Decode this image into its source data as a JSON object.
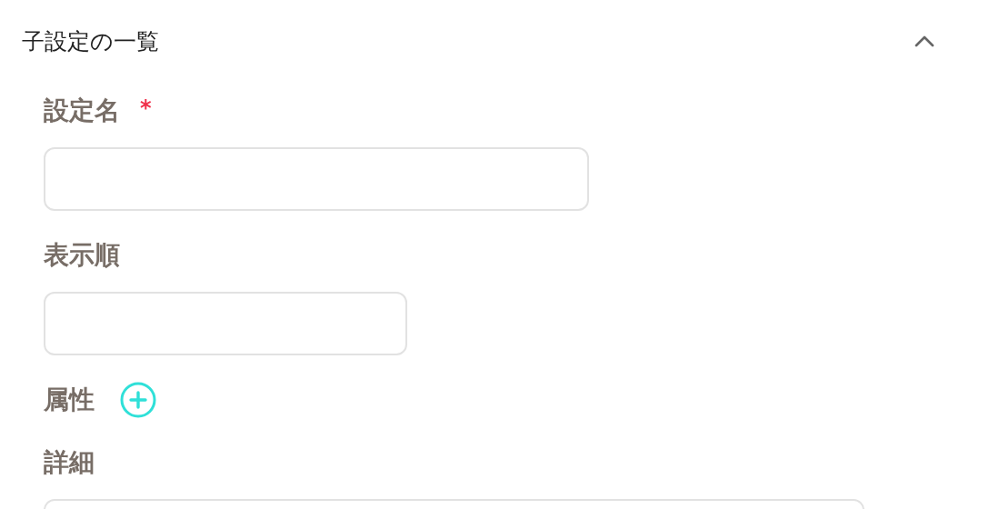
{
  "section": {
    "title": "子設定の一覧",
    "expanded": true
  },
  "fields": [
    {
      "kind": "wide_input",
      "label": "設定名",
      "required_mark": "*"
    },
    {
      "kind": "narrow_input",
      "label": "表示順"
    },
    {
      "kind": "add",
      "label": "属性"
    },
    {
      "kind": "textarea",
      "label": "詳細"
    }
  ]
}
